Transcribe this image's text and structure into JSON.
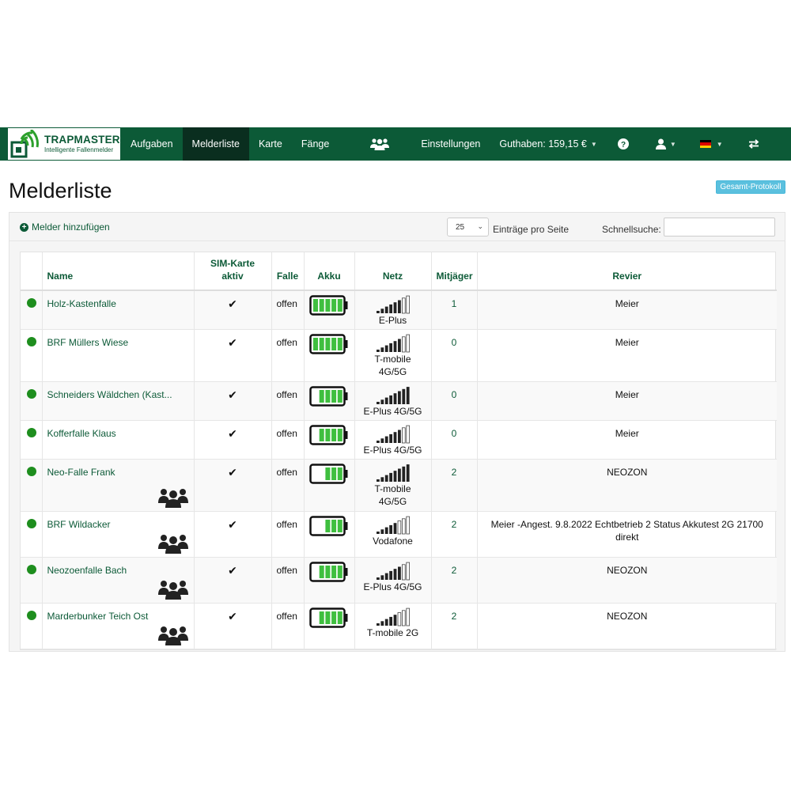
{
  "brand": {
    "title": "TRAPMASTER",
    "subtitle": "Intelligente Fallenmelder",
    "green": "#0c5a37"
  },
  "nav": {
    "aufgaben": "Aufgaben",
    "melderliste": "Melderliste",
    "karte": "Karte",
    "faenge": "Fänge",
    "einstellungen": "Einstellungen",
    "guthaben": "Guthaben: 159,15 €",
    "active": "Melderliste"
  },
  "page": {
    "title": "Melderliste",
    "protocol_button": "Gesamt-Protokoll"
  },
  "toolbar": {
    "add_label": "Melder hinzufügen",
    "per_page_value": "25",
    "per_page_label": "Einträge pro Seite",
    "search_label": "Schnellsuche:",
    "search_value": ""
  },
  "table": {
    "headers": {
      "name": "Name",
      "sim_line1": "SIM-Karte",
      "sim_line2": "aktiv",
      "falle": "Falle",
      "akku": "Akku",
      "netz": "Netz",
      "mitjaeger": "Mitjäger",
      "revier": "Revier"
    },
    "rows": [
      {
        "name": "Holz-Kastenfalle",
        "sim": "✔",
        "falle": "offen",
        "battery_bars": 5,
        "signal_bars": 4,
        "netz": [
          "E-Plus"
        ],
        "mitjaeger": "1",
        "revier": "Meier",
        "team": false
      },
      {
        "name": "BRF Müllers Wiese",
        "sim": "✔",
        "falle": "offen",
        "battery_bars": 5,
        "signal_bars": 4,
        "netz": [
          "T-mobile",
          "4G/5G"
        ],
        "mitjaeger": "0",
        "revier": "Meier",
        "team": false
      },
      {
        "name": "Schneiders Wäldchen (Kast...",
        "sim": "✔",
        "falle": "offen",
        "battery_bars": 4,
        "signal_bars": 5,
        "netz": [
          "E-Plus 4G/5G"
        ],
        "mitjaeger": "0",
        "revier": "Meier",
        "team": false
      },
      {
        "name": "Kofferfalle Klaus",
        "sim": "✔",
        "falle": "offen",
        "battery_bars": 4,
        "signal_bars": 4,
        "netz": [
          "E-Plus 4G/5G"
        ],
        "mitjaeger": "0",
        "revier": "Meier",
        "team": false
      },
      {
        "name": "Neo-Falle Frank",
        "sim": "✔",
        "falle": "offen",
        "battery_bars": 3,
        "signal_bars": 5,
        "netz": [
          "T-mobile",
          "4G/5G"
        ],
        "mitjaeger": "2",
        "revier": "NEOZON",
        "team": true
      },
      {
        "name": "BRF Wildacker",
        "sim": "✔",
        "falle": "offen",
        "battery_bars": 3,
        "signal_bars": 3,
        "netz": [
          "Vodafone"
        ],
        "mitjaeger": "2",
        "revier": "Meier -Angest. 9.8.2022 Echtbetrieb 2 Status Akkutest 2G 21700 direkt",
        "team": true
      },
      {
        "name": "Neozoenfalle Bach",
        "sim": "✔",
        "falle": "offen",
        "battery_bars": 4,
        "signal_bars": 4,
        "netz": [
          "E-Plus 4G/5G"
        ],
        "mitjaeger": "2",
        "revier": "NEOZON",
        "team": true
      },
      {
        "name": "Marderbunker Teich Ost",
        "sim": "✔",
        "falle": "offen",
        "battery_bars": 4,
        "signal_bars": 3,
        "netz": [
          "T-mobile 2G"
        ],
        "mitjaeger": "2",
        "revier": "NEOZON",
        "team": true
      }
    ]
  },
  "icons": {
    "users": "users-icon",
    "help": "question-circle-icon",
    "user": "user-icon",
    "flag": "german-flag-icon",
    "switch": "transfer-icon"
  }
}
